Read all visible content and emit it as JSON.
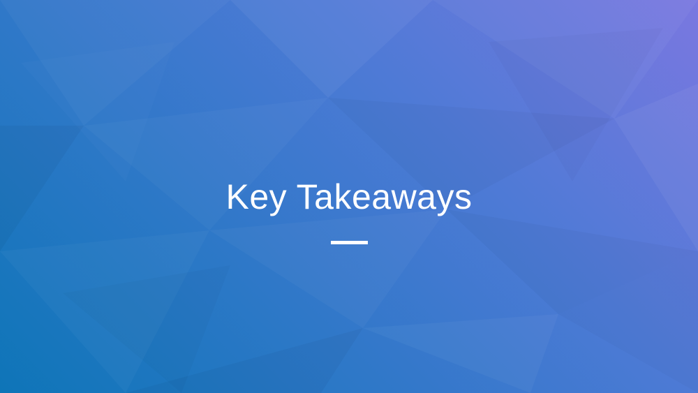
{
  "slide": {
    "title": "Key Takeaways"
  },
  "colors": {
    "gradient_start": "#0e75b8",
    "gradient_end": "#7a78e0",
    "text": "#ffffff"
  }
}
